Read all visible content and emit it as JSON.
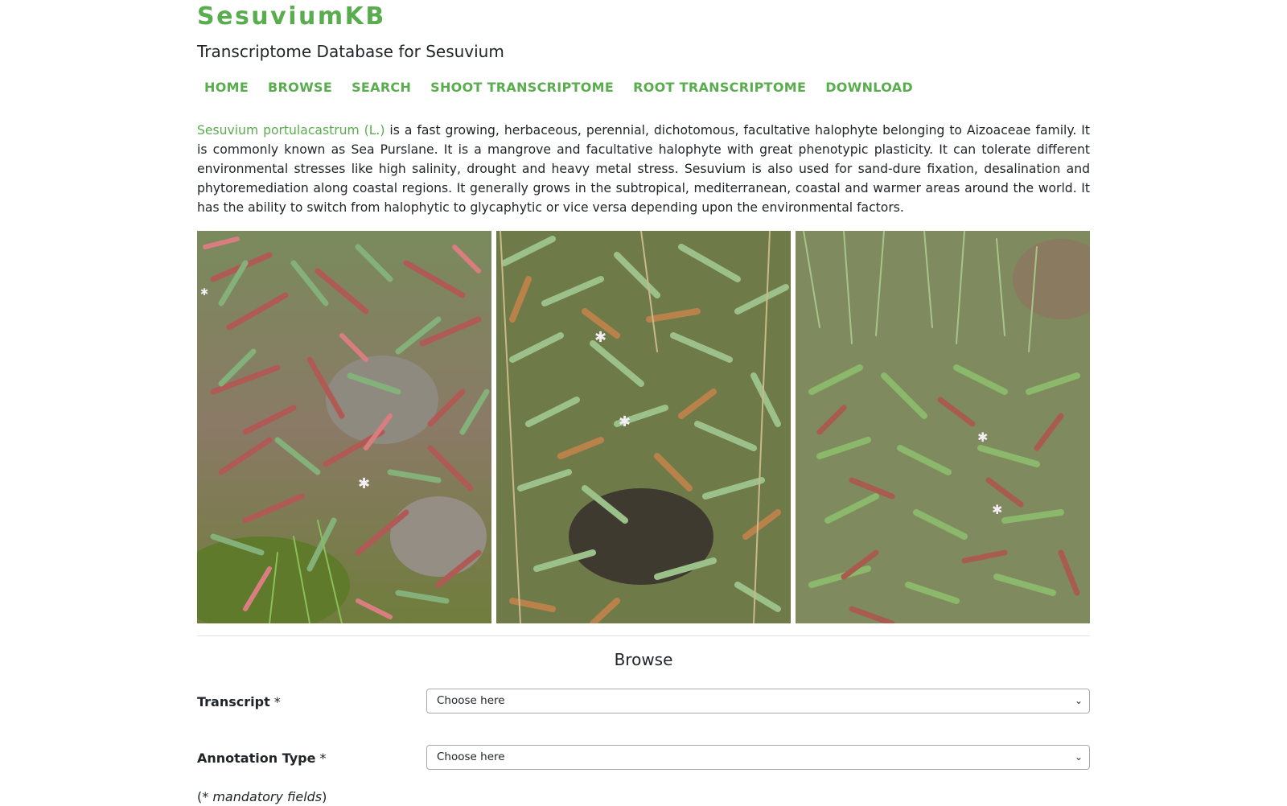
{
  "site": {
    "title": "SesuviumKB",
    "subtitle": "Transcriptome Database for Sesuvium",
    "brand_color": "#5aad4e"
  },
  "nav": {
    "items": [
      {
        "label": "HOME"
      },
      {
        "label": "BROWSE"
      },
      {
        "label": "SEARCH"
      },
      {
        "label": "SHOOT TRANSCRIPTOME"
      },
      {
        "label": "ROOT TRANSCRIPTOME"
      },
      {
        "label": "DOWNLOAD"
      }
    ]
  },
  "intro": {
    "species_link": "Sesuvium portulacastrum (L.)",
    "text": " is a fast growing, herbaceous, perennial, dichotomous, facultative halophyte belonging to Aizoaceae family. It is commonly known as Sea Purslane. It is a mangrove and facultative halophyte with great phenotypic plasticity. It can tolerate different environmental stresses like high salinity, drought and heavy metal stress. Sesuvium is also used for sand-dure fixation, desalination and phytoremediation along coastal regions. It generally grows in the subtropical, mediterranean, coastal and warmer areas around the world. It has the ability to switch from halophytic to glycaphytic or vice versa depending upon the environmental factors."
  },
  "browse": {
    "title": "Browse",
    "transcript": {
      "label": "Transcript",
      "required_mark": " *",
      "selected": "Choose here"
    },
    "annotation_type": {
      "label": "Annotation Type",
      "required_mark": " *",
      "selected": "Choose here"
    },
    "note_open": "(",
    "note_text": "* mandatory fields",
    "note_close": ")"
  }
}
